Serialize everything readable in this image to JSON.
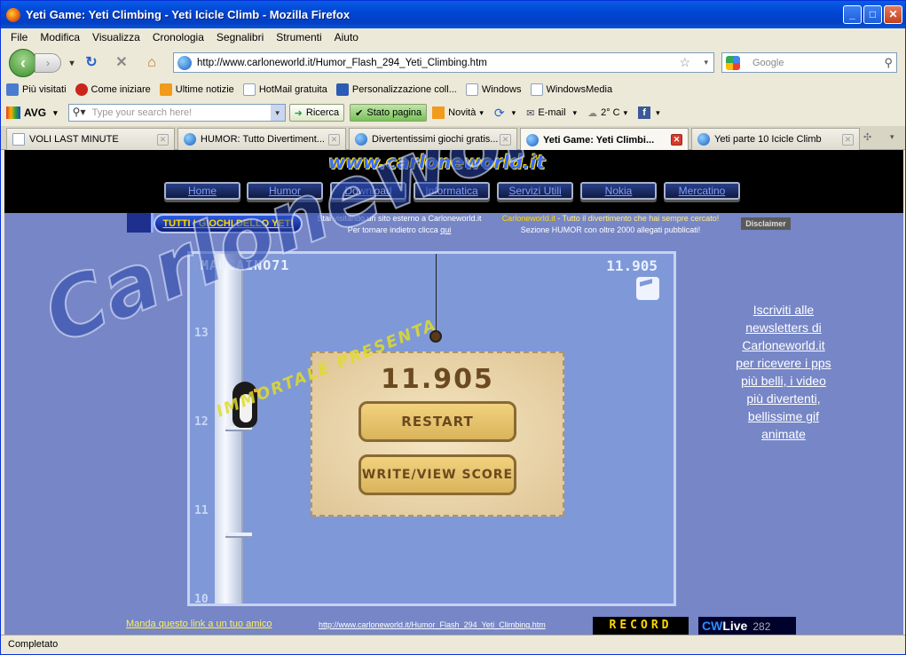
{
  "window": {
    "title": "Yeti Game: Yeti Climbing - Yeti Icicle Climb - Mozilla Firefox"
  },
  "menu": [
    "File",
    "Modifica",
    "Visualizza",
    "Cronologia",
    "Segnalibri",
    "Strumenti",
    "Aiuto"
  ],
  "nav": {
    "url": "http://www.carloneworld.it/Humor_Flash_294_Yeti_Climbing.htm",
    "search_placeholder": "Google"
  },
  "bookmarks": [
    "Più visitati",
    "Come iniziare",
    "Ultime notizie",
    "HotMail gratuita",
    "Personalizzazione coll...",
    "Windows",
    "WindowsMedia"
  ],
  "avg": {
    "logo": "AVG",
    "search_placeholder": "Type your search here!",
    "search_btn": "Ricerca",
    "status_btn": "Stato pagina",
    "news": "Novità",
    "email": "E-mail",
    "weather": "2° C"
  },
  "tabs": [
    {
      "label": "VOLI LAST MINUTE",
      "icon": "page"
    },
    {
      "label": "HUMOR: Tutto Divertiment...",
      "icon": "ie"
    },
    {
      "label": "Divertentissimi giochi gratis...",
      "icon": "ie"
    },
    {
      "label": "Yeti Game: Yeti Climbi...",
      "icon": "ie",
      "active": true
    },
    {
      "label": "Yeti parte 10 Icicle Climb",
      "icon": "ie"
    }
  ],
  "site": {
    "logo": "www.carloneworld.it",
    "nav": [
      "Home",
      "Humor",
      "Download",
      "Informatica",
      "Servizi Utili",
      "Nokia",
      "Mercatino"
    ],
    "yeti_button": "TUTTI I GIOCHI DELLO YETI",
    "info_line1": "Stai visitando un sito esterno a Carloneworld.it",
    "info_line2_prefix": "Per tornare indietro clicca",
    "info_line2_link": "qui",
    "tagline1_brand": "Carloneworld.it",
    "tagline1_rest": " - Tutto il divertimento che hai sempre cercato!",
    "tagline2": "Sezione HUMOR con oltre 2000 allegati pubblicati!",
    "disclaimer": "Disclaimer",
    "newsletter": "Iscriviti alle newsletters di Carloneworld.it per ricevere i pps più belli, i video più divertenti, bellissime gif animate",
    "footer_link": "Manda questo link a un tuo amico",
    "footer_url": "http://www.carloneworld.it/Humor_Flash_294_Yeti_Climbing.htm",
    "record": "RECORD",
    "cwlive_cw": "CW",
    "cwlive_live": "Live",
    "cwlive_count": "282",
    "watermark": "Carloneworld.it",
    "watermark_sub": "IMMORTALE PRESENTA"
  },
  "game": {
    "player": "MAUCAINO71",
    "score_top": "11.905",
    "score_big": "11.905",
    "restart": "RESTART",
    "write_view": "WRITE/VIEW SCORE",
    "levels": [
      "13",
      "12",
      "11",
      "10"
    ]
  },
  "status": "Completato"
}
